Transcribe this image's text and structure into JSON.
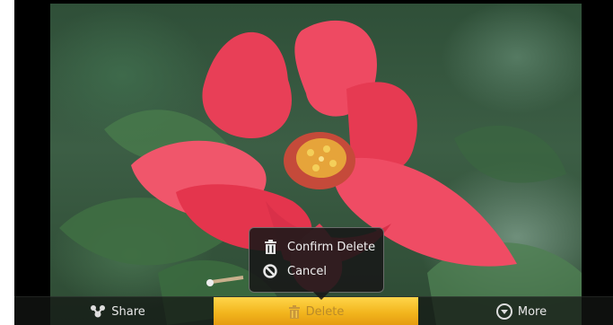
{
  "popup_menu": {
    "confirm_delete_label": "Confirm Delete",
    "confirm_delete_icon": "trash-icon",
    "cancel_label": "Cancel",
    "cancel_icon": "block-icon"
  },
  "action_bar": {
    "share_label": "Share",
    "share_icon": "share-icon",
    "delete_label": "Delete",
    "delete_icon": "trash-icon",
    "more_label": "More",
    "more_icon": "chevron-down-circle-icon"
  },
  "colors": {
    "delete_highlight": "#f2b51d",
    "bar_background": "#141614",
    "popup_background": "#181818"
  }
}
